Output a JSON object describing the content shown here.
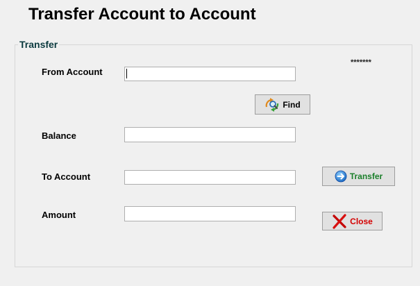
{
  "window": {
    "title": "Transfer Account to Account"
  },
  "group": {
    "title": "Transfer"
  },
  "fields": {
    "from_account": {
      "label": "From Account",
      "value": ""
    },
    "balance": {
      "label": "Balance",
      "value": ""
    },
    "to_account": {
      "label": "To Account",
      "value": ""
    },
    "amount": {
      "label": "Amount",
      "value": ""
    }
  },
  "mask_text": "*******",
  "buttons": {
    "find": {
      "label": "Find",
      "icon": "search-refresh-icon"
    },
    "transfer": {
      "label": "Transfer",
      "icon": "arrow-right-circle-icon",
      "color": "#1a7f2a"
    },
    "close": {
      "label": "Close",
      "icon": "red-x-icon",
      "color": "#d40000"
    }
  },
  "colors": {
    "background": "#f0f0f0",
    "group_title": "#0b3a3f"
  }
}
